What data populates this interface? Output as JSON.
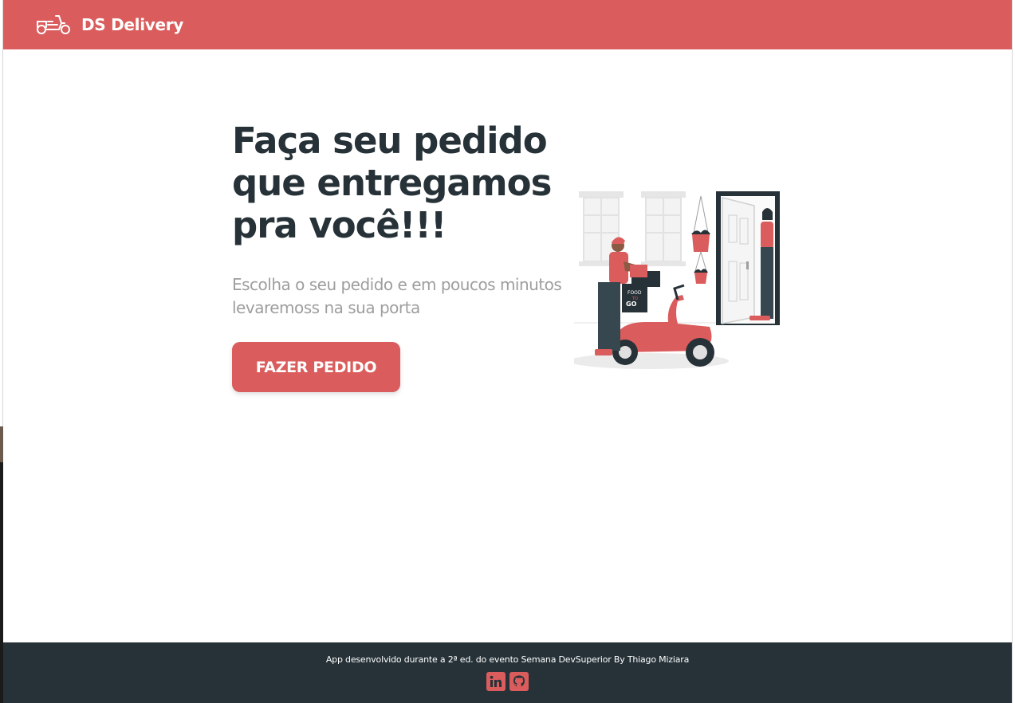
{
  "navbar": {
    "brand": "DS Delivery",
    "logo_icon": "scooter-icon",
    "background_color": "#da5c5c"
  },
  "hero": {
    "title_lines": [
      "Faça seu pedido",
      "que entregamos",
      "pra você!!!"
    ],
    "subtitle_lines": [
      "Escolha o seu pedido e em poucos minutos",
      "levaremoss na sua porta"
    ],
    "button_label": "FAZER PEDIDO",
    "illustration": "delivery-scooter-illustration",
    "illustration_box_text": [
      "FOOD",
      "TO",
      "GO"
    ]
  },
  "footer": {
    "text": "App desenvolvido durante a 2ª ed. do evento Semana DevSuperior By Thiago Miziara",
    "icons": [
      "linkedin-icon",
      "github-icon"
    ],
    "background_color": "#263238"
  },
  "colors": {
    "accent": "#da5c5c",
    "dark": "#263238",
    "muted_text": "#9e9e9e"
  }
}
